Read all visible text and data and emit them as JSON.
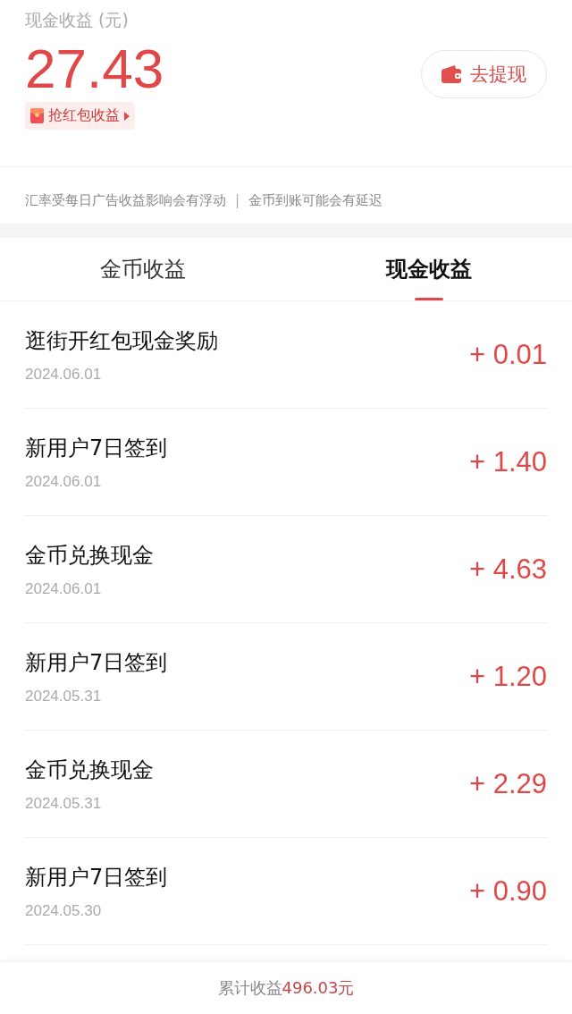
{
  "balance": {
    "label": "现金收益 (元)",
    "amount": "27.43",
    "red_packet_link": "抢红包收益",
    "withdraw_button": "去提现"
  },
  "notice": {
    "left": "汇率受每日广告收益影响会有浮动",
    "separator": "|",
    "right": "金币到账可能会有延迟"
  },
  "tabs": [
    {
      "label": "金币收益",
      "selected": false
    },
    {
      "label": "现金收益",
      "selected": true
    }
  ],
  "records": [
    {
      "title": "逛街开红包现金奖励",
      "date": "2024.06.01",
      "amount": "+ 0.01"
    },
    {
      "title": "新用户7日签到",
      "date": "2024.06.01",
      "amount": "+ 1.40"
    },
    {
      "title": "金币兑换现金",
      "date": "2024.06.01",
      "amount": "+ 4.63"
    },
    {
      "title": "新用户7日签到",
      "date": "2024.05.31",
      "amount": "+ 1.20"
    },
    {
      "title": "金币兑换现金",
      "date": "2024.05.31",
      "amount": "+ 2.29"
    },
    {
      "title": "新用户7日签到",
      "date": "2024.05.30",
      "amount": "+ 0.90"
    }
  ],
  "footer": {
    "label": "累计收益",
    "total": "496.03元"
  }
}
